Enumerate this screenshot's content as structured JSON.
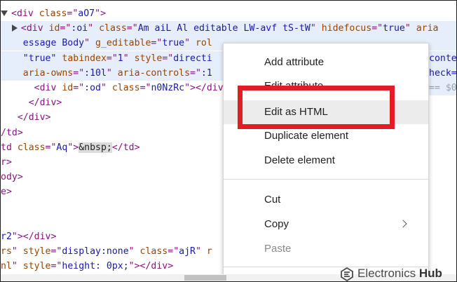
{
  "devtools": {
    "top_clip": "                       ~    ~      ~",
    "lines": [
      {
        "indent": "",
        "toggle": "down",
        "parts": [
          [
            "tag",
            "<div "
          ],
          [
            "attr",
            "class"
          ],
          [
            "tag",
            "=\""
          ],
          [
            "val",
            "aO7"
          ],
          [
            "tag",
            "\">"
          ]
        ]
      },
      {
        "indent": "  ",
        "toggle": "right",
        "highlight": true,
        "parts": [
          [
            "tag",
            "<div "
          ],
          [
            "attr",
            "id"
          ],
          [
            "tag",
            "=\""
          ],
          [
            "val",
            ":oi"
          ],
          [
            "tag",
            "\" "
          ],
          [
            "attr",
            "class"
          ],
          [
            "tag",
            "=\""
          ],
          [
            "val",
            "Am aiL Al editable LW-avf tS-tW"
          ],
          [
            "tag",
            "\" "
          ],
          [
            "attr",
            "hidefocus"
          ],
          [
            "tag",
            "=\""
          ],
          [
            "val",
            "true"
          ],
          [
            "tag",
            "\" "
          ],
          [
            "attr",
            "aria"
          ]
        ]
      },
      {
        "indent": "  ",
        "toggle": "",
        "highlight": true,
        "parts": [
          [
            "val",
            "essage Body"
          ],
          [
            "tag",
            "\" "
          ],
          [
            "attr",
            "g_editable"
          ],
          [
            "tag",
            "=\""
          ],
          [
            "val",
            "true"
          ],
          [
            "tag",
            "\" "
          ],
          [
            "attr",
            "rol"
          ]
        ]
      },
      {
        "indent": "  ",
        "toggle": "",
        "highlight": true,
        "parts": [
          [
            "val",
            "\"true\""
          ],
          [
            "tag",
            " "
          ],
          [
            "attr",
            "tabindex"
          ],
          [
            "tag",
            "=\""
          ],
          [
            "val",
            "1"
          ],
          [
            "tag",
            "\" "
          ],
          [
            "attr",
            "style"
          ],
          [
            "tag",
            "=\""
          ],
          [
            "val",
            "directi"
          ]
        ]
      },
      {
        "indent": "  ",
        "toggle": "",
        "highlight": true,
        "parts": [
          [
            "attr",
            "aria-owns"
          ],
          [
            "tag",
            "=\""
          ],
          [
            "val",
            ":10l"
          ],
          [
            "tag",
            "\" "
          ],
          [
            "attr",
            "aria-controls"
          ],
          [
            "tag",
            "=\""
          ],
          [
            "val",
            ":1"
          ]
        ]
      },
      {
        "indent": "    ",
        "toggle": "",
        "parts": [
          [
            "tag",
            "<div "
          ],
          [
            "attr",
            "id"
          ],
          [
            "tag",
            "=\""
          ],
          [
            "val",
            ":od"
          ],
          [
            "tag",
            "\" "
          ],
          [
            "attr",
            "class"
          ],
          [
            "tag",
            "=\""
          ],
          [
            "val",
            "n0NzRc"
          ],
          [
            "tag",
            "\"></div>"
          ]
        ]
      },
      {
        "indent": "   ",
        "toggle": "",
        "parts": [
          [
            "tag",
            "</div>"
          ]
        ]
      },
      {
        "indent": " ",
        "toggle": "",
        "parts": [
          [
            "tag",
            "</div>"
          ]
        ]
      },
      {
        "indent": "",
        "toggle": "",
        "parts": [
          [
            "tag",
            "/td>"
          ]
        ]
      },
      {
        "indent": "",
        "toggle": "",
        "parts": [
          [
            "tag",
            "td "
          ],
          [
            "attr",
            "class"
          ],
          [
            "tag",
            "=\""
          ],
          [
            "val",
            "Aq"
          ],
          [
            "tag",
            "\">"
          ],
          [
            "ent",
            "&nbsp;"
          ],
          [
            "tag",
            "</td>"
          ]
        ]
      },
      {
        "indent": "",
        "toggle": "",
        "parts": [
          [
            "tag",
            "r>"
          ]
        ]
      },
      {
        "indent": "",
        "toggle": "",
        "parts": [
          [
            "tag",
            "ody>"
          ]
        ]
      },
      {
        "indent": "",
        "toggle": "",
        "parts": [
          [
            "tag",
            "e>"
          ]
        ]
      },
      {
        "indent": "",
        "toggle": "",
        "parts": []
      },
      {
        "indent": "",
        "toggle": "",
        "parts": []
      },
      {
        "indent": "",
        "toggle": "",
        "parts": [
          [
            "val",
            "r2"
          ],
          [
            "tag",
            "\"></div>"
          ]
        ]
      },
      {
        "indent": "",
        "toggle": "",
        "parts": [
          [
            "attr",
            "rs"
          ],
          [
            "tag",
            "\" "
          ],
          [
            "attr",
            "style"
          ],
          [
            "tag",
            "=\""
          ],
          [
            "val",
            "display:none"
          ],
          [
            "tag",
            "\" "
          ],
          [
            "attr",
            "class"
          ],
          [
            "tag",
            "=\""
          ],
          [
            "val",
            "ajR"
          ],
          [
            "tag",
            "\" "
          ],
          [
            "attr",
            "r"
          ]
        ]
      },
      {
        "indent": "",
        "toggle": "",
        "parts": [
          [
            "attr",
            "nl"
          ],
          [
            "tag",
            "\" "
          ],
          [
            "attr",
            "style"
          ],
          [
            "tag",
            "=\""
          ],
          [
            "val",
            "height: 0px;"
          ],
          [
            "tag",
            "\"></div>"
          ]
        ]
      }
    ],
    "right_edge_text": [
      {
        "line": 3,
        "text": "conten"
      },
      {
        "line": 4,
        "text": "heck="
      },
      {
        "line": 5,
        "text": "== $0"
      }
    ]
  },
  "context_menu": {
    "items": [
      {
        "label": "Add attribute"
      },
      {
        "label": "Edit attribute"
      },
      {
        "label": "Edit as HTML",
        "hover": true
      },
      {
        "label": "Duplicate element"
      },
      {
        "label": "Delete element"
      },
      {
        "label": "Cut"
      },
      {
        "label": "Copy",
        "submenu": true
      },
      {
        "label": "Paste",
        "disabled": true
      }
    ]
  },
  "annotation": {
    "box_color": "#e21d23"
  },
  "watermark": {
    "brand": "Electronics",
    "hub": "Hub"
  }
}
